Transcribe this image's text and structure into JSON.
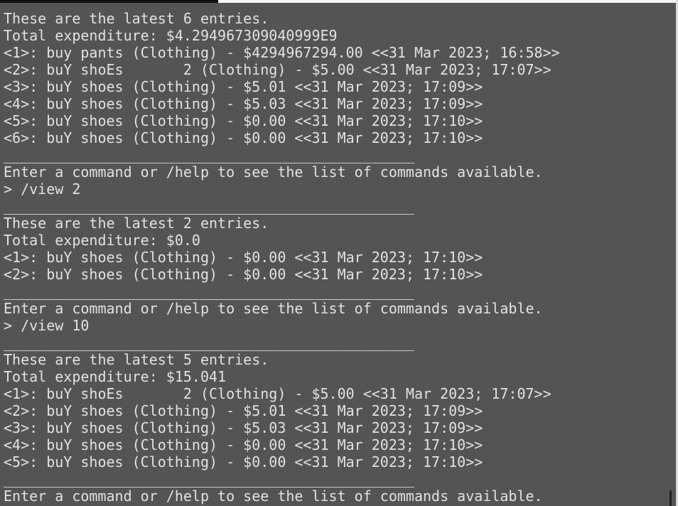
{
  "terminal": {
    "lines": [
      "These are the latest 6 entries.",
      "Total expenditure: $4.294967309040999E9",
      "<1>: buy pants (Clothing) - $4294967294.00 <<31 Mar 2023; 16:58>>",
      "<2>: buY shoEs       2 (Clothing) - $5.00 <<31 Mar 2023; 17:07>>",
      "<3>: buY shoes (Clothing) - $5.01 <<31 Mar 2023; 17:09>>",
      "<4>: buY shoes (Clothing) - $5.03 <<31 Mar 2023; 17:09>>",
      "<5>: buY shoes (Clothing) - $0.00 <<31 Mar 2023; 17:10>>",
      "<6>: buY shoes (Clothing) - $0.00 <<31 Mar 2023; 17:10>>",
      "________________________________________________",
      "Enter a command or /help to see the list of commands available.",
      "> /view 2",
      "________________________________________________",
      "These are the latest 2 entries.",
      "Total expenditure: $0.0",
      "<1>: buY shoes (Clothing) - $0.00 <<31 Mar 2023; 17:10>>",
      "<2>: buY shoes (Clothing) - $0.00 <<31 Mar 2023; 17:10>>",
      "________________________________________________",
      "Enter a command or /help to see the list of commands available.",
      "> /view 10",
      "________________________________________________",
      "These are the latest 5 entries.",
      "Total expenditure: $15.041",
      "<1>: buY shoEs       2 (Clothing) - $5.00 <<31 Mar 2023; 17:07>>",
      "<2>: buY shoes (Clothing) - $5.01 <<31 Mar 2023; 17:09>>",
      "<3>: buY shoes (Clothing) - $5.03 <<31 Mar 2023; 17:09>>",
      "<4>: buY shoes (Clothing) - $0.00 <<31 Mar 2023; 17:10>>",
      "<5>: buY shoes (Clothing) - $0.00 <<31 Mar 2023; 17:10>>",
      "________________________________________________",
      "Enter a command or /help to see the list of commands available."
    ]
  },
  "colors": {
    "background": "#545454",
    "text": "#e2e2e2"
  }
}
